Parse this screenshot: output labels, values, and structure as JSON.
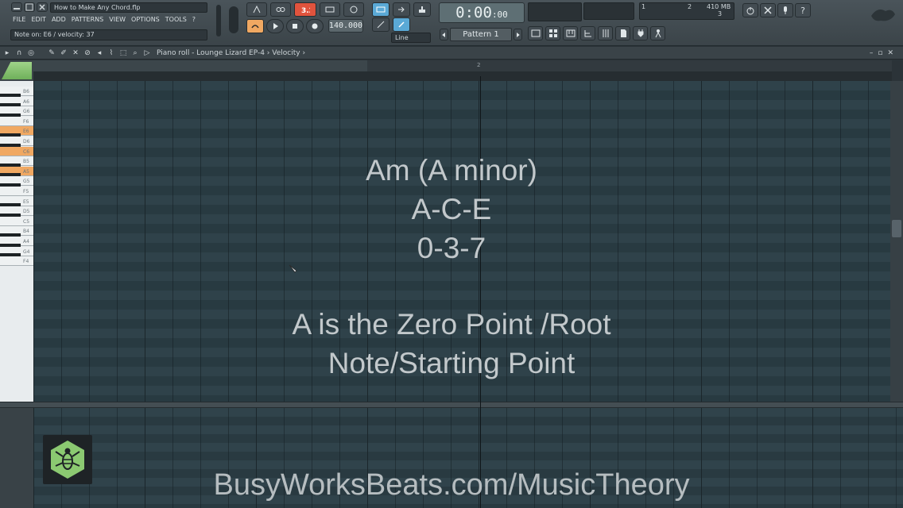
{
  "window": {
    "filename": "How to Make Any Chord.flp",
    "hint": "Note on: E6 / velocity: 37"
  },
  "menu": [
    "FILE",
    "EDIT",
    "ADD",
    "PATTERNS",
    "VIEW",
    "OPTIONS",
    "TOOLS",
    "?"
  ],
  "transport": {
    "time": "0:00",
    "time_small": ":00",
    "tempo": "140.000",
    "pattern": "Pattern 1",
    "snap": "Line",
    "memory": "410 MB",
    "cpu_top": "2",
    "cpu_bottom": "3",
    "song_pos": "1"
  },
  "piano_roll": {
    "title": "Piano roll - Lounge Lizard EP-4",
    "target": "Velocity",
    "ruler_marker": "2"
  },
  "keyboard": {
    "labels": [
      "B6",
      "A6",
      "G6",
      "F6",
      "E6",
      "D6",
      "C6",
      "B5",
      "A5",
      "G5",
      "F5",
      "E5",
      "D5",
      "C5",
      "B4",
      "A4",
      "G4",
      "F4"
    ],
    "highlighted": [
      "E6",
      "C6",
      "A5"
    ]
  },
  "overlay": {
    "line1": "Am (A minor)",
    "line2": "A-C-E",
    "line3": "0-3-7",
    "line4": "A is the Zero Point /Root",
    "line5": "Note/Starting Point",
    "watermark": "BusyWorksBeats.com/MusicTheory"
  },
  "colors": {
    "accent_orange": "#f0a862",
    "accent_green": "#8bc971",
    "grid_bg": "#2c3d45",
    "record_red": "#e0533d"
  }
}
